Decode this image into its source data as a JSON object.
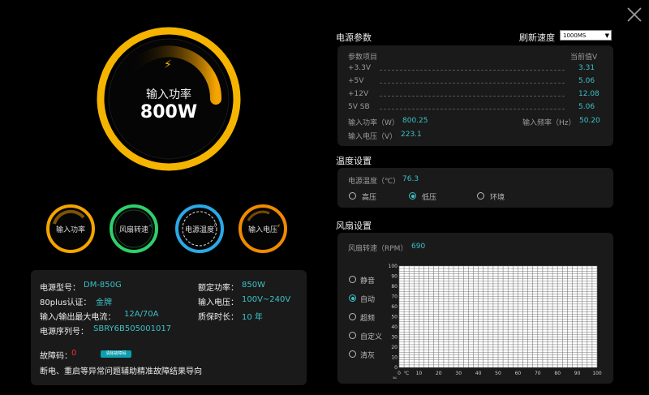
{
  "gauge_main": {
    "label": "输入功率",
    "value": "800W"
  },
  "small_gauges": [
    {
      "label": "输入功率"
    },
    {
      "label": "风扇转速"
    },
    {
      "label": "电源温度"
    },
    {
      "label": "输入电压"
    }
  ],
  "params": {
    "title": "电源参数",
    "refresh_label": "刷新速度",
    "refresh_value": "1000MS",
    "header_item": "参数项目",
    "header_value": "当前值V",
    "rows": [
      {
        "name": "+3.3V",
        "value": "3.31"
      },
      {
        "name": "+5V",
        "value": "5.06"
      },
      {
        "name": "+12V",
        "value": "12.08"
      },
      {
        "name": "5V SB",
        "value": "5.06"
      }
    ],
    "input_power_label": "输入功率（W）",
    "input_power_value": "800.25",
    "input_freq_label": "输入频率（Hz）",
    "input_freq_value": "50.20",
    "input_voltage_label": "输入电压（V）",
    "input_voltage_value": "223.1"
  },
  "temp": {
    "title": "温度设置",
    "label": "电源温度（℃）",
    "value": "76.3",
    "options": [
      "高压",
      "低压",
      "环境"
    ],
    "selected": 1
  },
  "fan": {
    "title": "风扇设置",
    "label": "风扇转速（RPM）",
    "value": "690",
    "modes": [
      "静音",
      "自动",
      "超频",
      "自定义",
      "清灰"
    ],
    "selected": 1
  },
  "chart_data": {
    "type": "line",
    "x_ticks": [
      0,
      10,
      20,
      30,
      40,
      50,
      60,
      70,
      80,
      90,
      100
    ],
    "y_ticks": [
      0,
      10,
      20,
      30,
      40,
      50,
      60,
      70,
      80,
      90,
      100
    ],
    "xlabel": "℃",
    "ylabel": "%",
    "xlim": [
      0,
      100
    ],
    "ylim": [
      0,
      100
    ],
    "grid": true,
    "series": []
  },
  "info": {
    "model_label": "电源型号：",
    "model_value": "DM-850G",
    "rated_label": "额定功率：",
    "rated_value": "850W",
    "cert_label": "80plus认证：",
    "cert_value": "金牌",
    "vin_label": "输入电压：",
    "vin_value": "100V~240V",
    "maxcur_label": "输入/输出最大电流：",
    "maxcur_value": "12A/70A",
    "warranty_label": "质保时长：",
    "warranty_value": "10 年",
    "serial_label": "电源序列号：",
    "serial_value": "SBRY6B505001017",
    "fault_label": "故障码：",
    "fault_value": "0",
    "fault_button": "清除故障码",
    "fault_desc": "断电、重启等异常问题辅助精准故障结果导向"
  },
  "colors": {
    "accent": "#3cc0c6",
    "orange": "#f5a400",
    "green": "#2ed06b",
    "blue": "#2aa9e6"
  }
}
